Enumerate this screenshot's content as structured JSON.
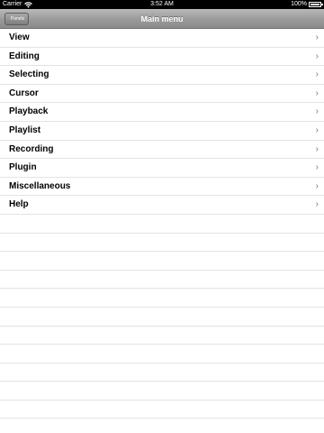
{
  "status_bar": {
    "carrier": "Carrier",
    "time": "3:52 AM",
    "battery": "100%"
  },
  "nav_bar": {
    "title": "Main menu",
    "back_label": "Panels"
  },
  "menu": {
    "items": [
      {
        "label": "View"
      },
      {
        "label": "Editing"
      },
      {
        "label": "Selecting"
      },
      {
        "label": "Cursor"
      },
      {
        "label": "Playback"
      },
      {
        "label": "Playlist"
      },
      {
        "label": "Recording"
      },
      {
        "label": "Plugin"
      },
      {
        "label": "Miscellaneous"
      },
      {
        "label": "Help"
      }
    ]
  },
  "chevron_glyph": "›"
}
